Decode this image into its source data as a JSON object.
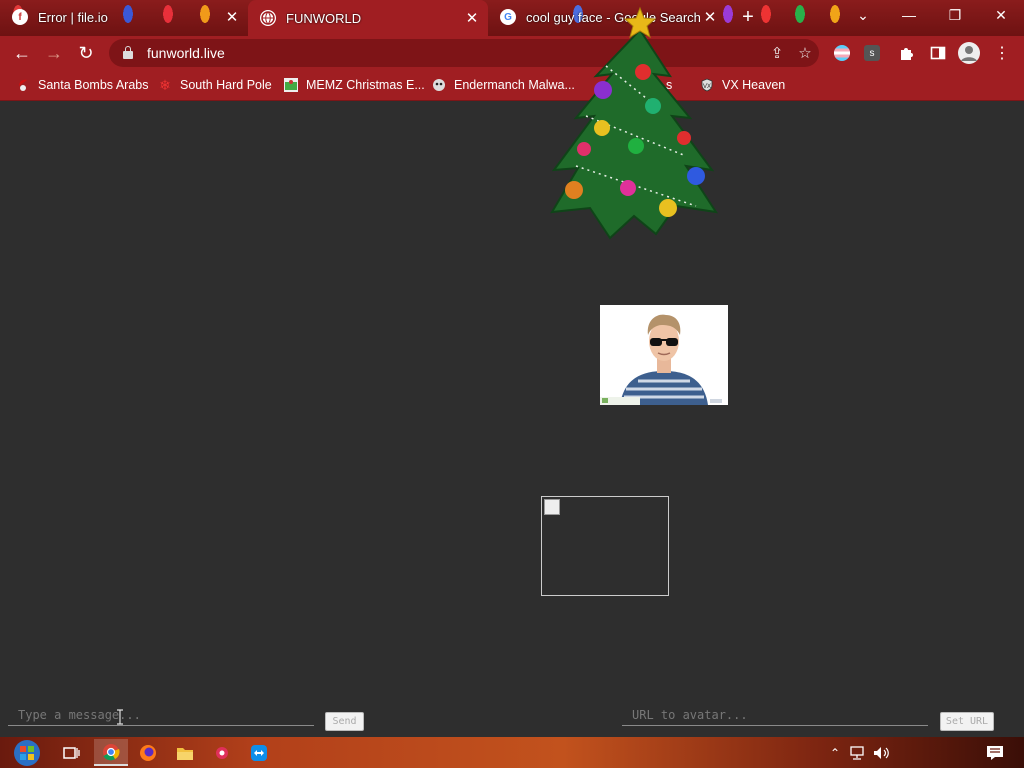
{
  "tabs": [
    {
      "title": "Error | file.io",
      "close": "✕"
    },
    {
      "title": "FUNWORLD",
      "close": "✕"
    },
    {
      "title": "cool guy face - Google Search",
      "close": "✕"
    }
  ],
  "new_tab": "+",
  "window_controls": {
    "tab_search": "⌄",
    "minimize": "—",
    "restore": "❐",
    "close": "✕"
  },
  "toolbar": {
    "back": "←",
    "forward": "→",
    "reload": "↻",
    "url": "funworld.live"
  },
  "bookmarks": [
    {
      "label": "Santa Bombs Arabs",
      "icon": "santa-icon"
    },
    {
      "label": "South Hard Pole",
      "icon": "snowflake-icon"
    },
    {
      "label": "MEMZ Christmas E...",
      "icon": "memz-icon"
    },
    {
      "label": "Endermanch Malwa...",
      "icon": "endermanch-icon"
    },
    {
      "label": "s",
      "icon": "folder-icon"
    },
    {
      "label": "VX Heaven",
      "icon": "vx-icon"
    }
  ],
  "chat": {
    "message_placeholder": "Type a message...",
    "send_label": "Send",
    "avatar_placeholder": "URL to avatar...",
    "set_label": "Set URL"
  },
  "colors": {
    "chrome": "#a01e22",
    "page_bg": "#2e2e2e",
    "tree_green": "#1f6b2a"
  }
}
